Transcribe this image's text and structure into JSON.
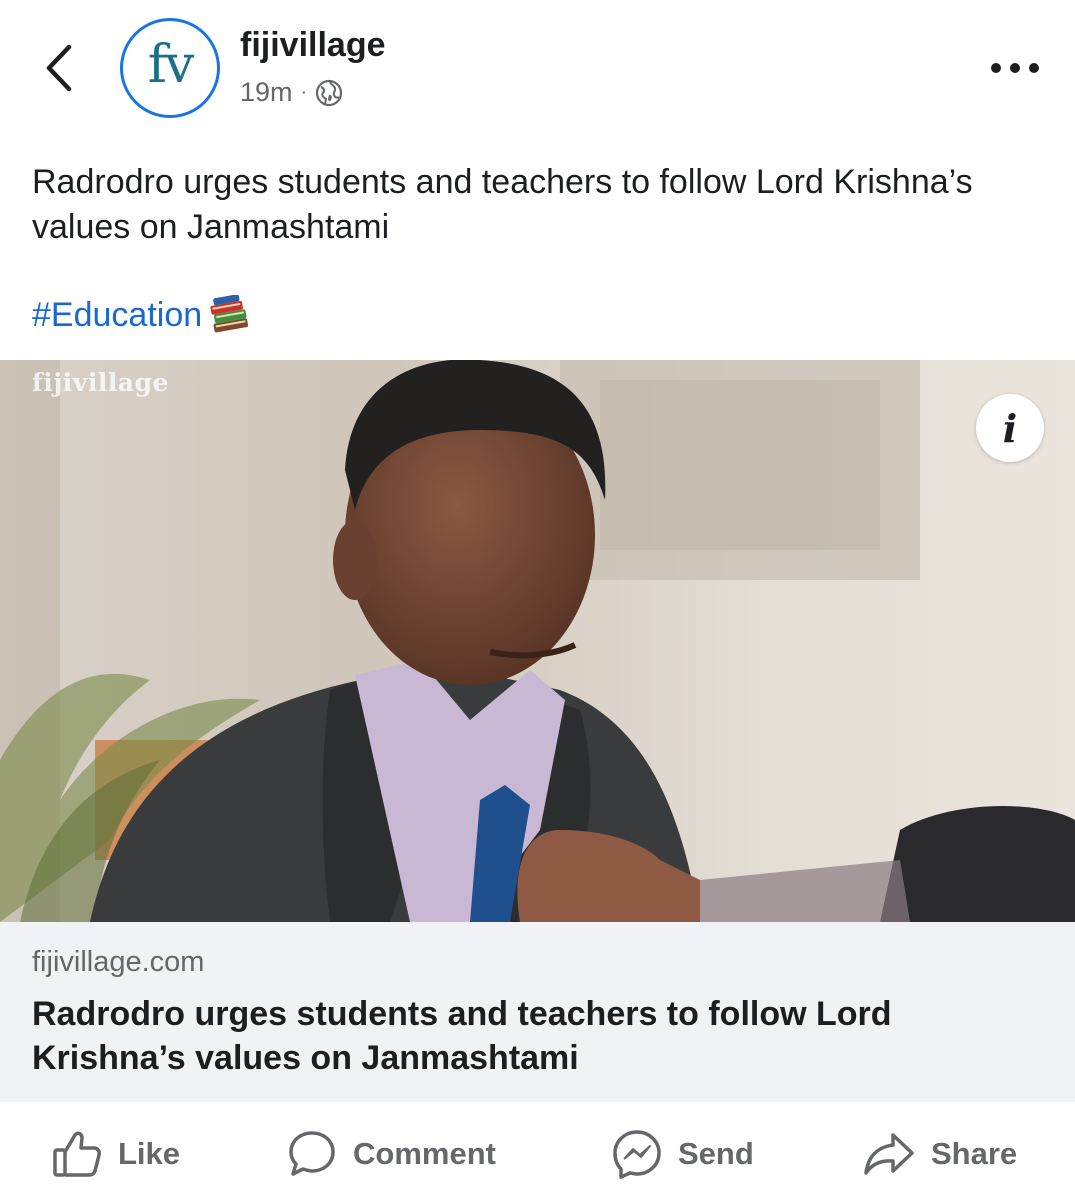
{
  "header": {
    "page_name": "fijivillage",
    "avatar_text": "fv",
    "timestamp": "19m",
    "separator": "·",
    "icons": {
      "back": "chevron-left-icon",
      "privacy": "globe-icon",
      "more": "more-dots-icon"
    }
  },
  "post": {
    "text": "Radrodro urges students and teachers to follow Lord Krishna’s values on Janmashtami",
    "hashtag": "#Education",
    "hashtag_icon": "books-emoji-icon"
  },
  "image": {
    "watermark": "fijivillage",
    "info_button": "i"
  },
  "link_card": {
    "domain": "fijivillage.com",
    "title": "Radrodro urges students and teachers to follow Lord Krishna’s values on Janmashtami"
  },
  "actions": [
    {
      "label": "Like",
      "icon": "thumbs-up-icon"
    },
    {
      "label": "Comment",
      "icon": "comment-bubble-icon"
    },
    {
      "label": "Send",
      "icon": "messenger-icon"
    },
    {
      "label": "Share",
      "icon": "share-arrow-icon"
    }
  ],
  "colors": {
    "link_blue": "#1a68d1",
    "avatar_ring": "#1a73e8",
    "secondary_text": "#65676b",
    "card_bg": "#f0f2f5"
  }
}
